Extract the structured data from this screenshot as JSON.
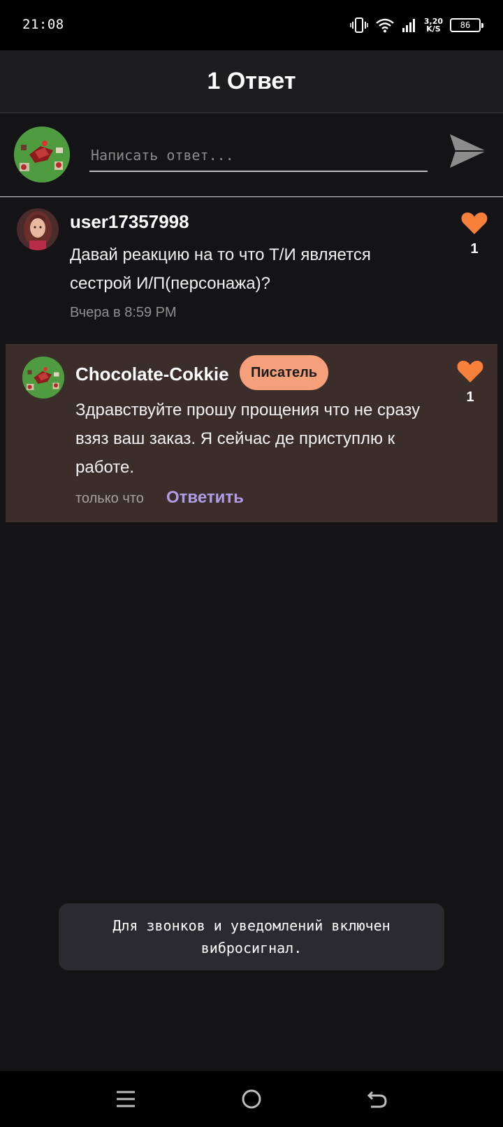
{
  "status_bar": {
    "time": "21:08",
    "network_speed_value": "3,20",
    "network_speed_unit": "K/S",
    "battery_level": "86",
    "icons": [
      "vibrate-icon",
      "wifi-icon",
      "signal-icon",
      "battery-icon"
    ]
  },
  "header": {
    "title": "1 Ответ"
  },
  "reply_input": {
    "placeholder": "Написать ответ..."
  },
  "comments": [
    {
      "username": "user17357998",
      "text": "Давай реакцию на то что Т/И является сестрой И/П(персонажа)?",
      "time": "Вчера в 8:59 PM",
      "likes": "1"
    },
    {
      "username": "Chocolate-Cokkie",
      "badge": "Писатель",
      "text": "Здравствуйте прошу прощения что не сразу взяз ваш заказ. Я сейчас де приступлю к работе.",
      "time": "только что",
      "reply_label": "Ответить",
      "likes": "1"
    }
  ],
  "toast": {
    "text": "Для звонков и уведомлений включен вибросигнал."
  },
  "colors": {
    "background": "#141316",
    "header": "#1d1c1f",
    "highlight_comment": "#3b2e2a",
    "like_heart": "#f7813b",
    "badge": "#f5a07a",
    "reply_link": "#b39ae6"
  }
}
